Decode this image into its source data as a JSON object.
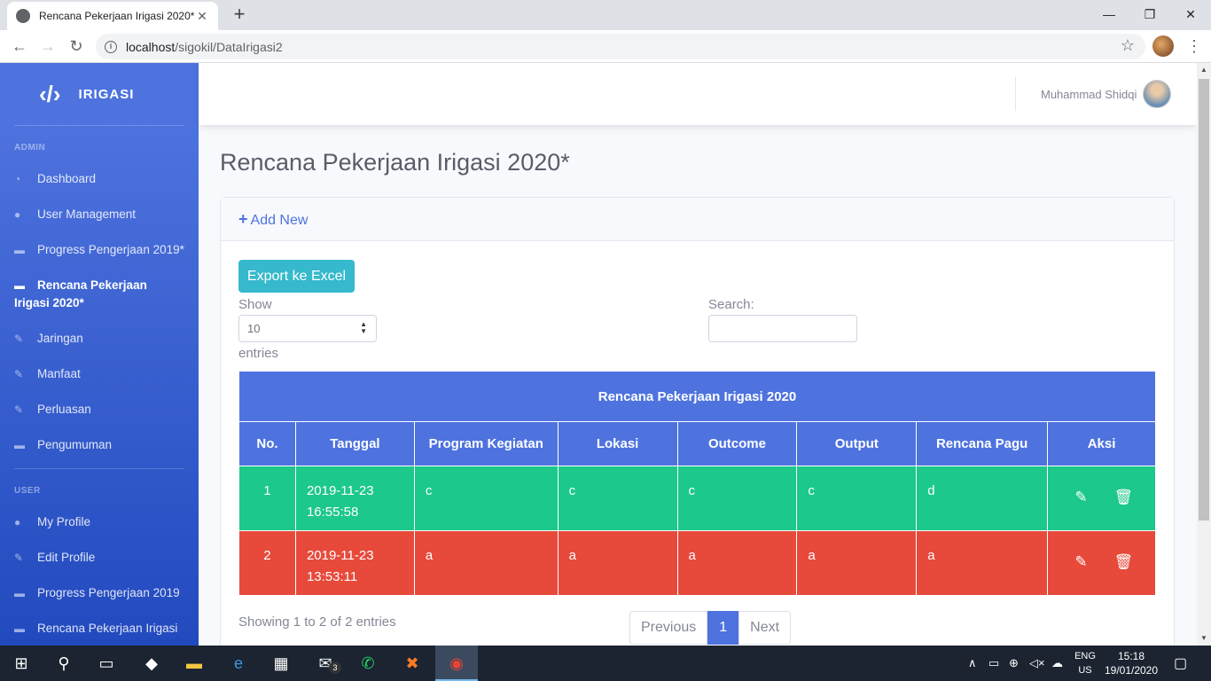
{
  "browser": {
    "tab_title": "Rencana Pekerjaan Irigasi 2020*",
    "url_host": "localhost",
    "url_path": "/sigokil/DataIrigasi2"
  },
  "sidebar": {
    "brand": "IRIGASI",
    "admin_heading": "ADMIN",
    "admin_items": [
      {
        "label": "Dashboard",
        "icon": "dashboard-icon"
      },
      {
        "label": "User Management",
        "icon": "user-icon"
      },
      {
        "label": "Progress Pengerjaan 2019*",
        "icon": "handshake-icon"
      },
      {
        "label": "Rencana Pekerjaan Irigasi 2020*",
        "icon": "handshake-icon",
        "active": true
      },
      {
        "label": "Jaringan",
        "icon": "edit-icon"
      },
      {
        "label": "Manfaat",
        "icon": "edit-icon"
      },
      {
        "label": "Perluasan",
        "icon": "edit-icon"
      },
      {
        "label": "Pengumuman",
        "icon": "handshake-icon"
      }
    ],
    "user_heading": "USER",
    "user_items": [
      {
        "label": "My Profile",
        "icon": "user-icon"
      },
      {
        "label": "Edit Profile",
        "icon": "edit-icon"
      },
      {
        "label": "Progress Pengerjaan 2019",
        "icon": "handshake-icon"
      },
      {
        "label": "Rencana Pekerjaan Irigasi",
        "icon": "handshake-icon"
      }
    ]
  },
  "topbar": {
    "username": "Muhammad Shidqi"
  },
  "main": {
    "page_title": "Rencana Pekerjaan Irigasi 2020*",
    "add_new": "Add New",
    "export_button": "Export ke Excel",
    "show_label": "Show",
    "entries_value": "10",
    "entries_label": "entries",
    "search_label": "Search:",
    "table": {
      "caption": "Rencana Pekerjaan Irigasi 2020",
      "columns": [
        "No.",
        "Tanggal",
        "Program Kegiatan",
        "Lokasi",
        "Outcome",
        "Output",
        "Rencana Pagu",
        "Aksi"
      ],
      "rows": [
        {
          "no": "1",
          "tanggal_date": "2019-11-23",
          "tanggal_time": "16:55:58",
          "program": "c",
          "lokasi": "c",
          "outcome": "c",
          "output": "c",
          "pagu": "d",
          "color": "#1cc88a"
        },
        {
          "no": "2",
          "tanggal_date": "2019-11-23",
          "tanggal_time": "13:53:11",
          "program": "a",
          "lokasi": "a",
          "outcome": "a",
          "output": "a",
          "pagu": "a",
          "color": "#e74a3b"
        }
      ]
    },
    "info": "Showing 1 to 2 of 2 entries",
    "pagination": {
      "previous": "Previous",
      "current": "1",
      "next": "Next"
    }
  },
  "taskbar": {
    "lang_top": "ENG",
    "lang_bottom": "US",
    "time": "15:18",
    "date": "19/01/2020",
    "mail_badge": "3"
  },
  "colors": {
    "primary": "#4e73df",
    "info": "#36b9cc",
    "success": "#1cc88a",
    "danger": "#e74a3b"
  }
}
